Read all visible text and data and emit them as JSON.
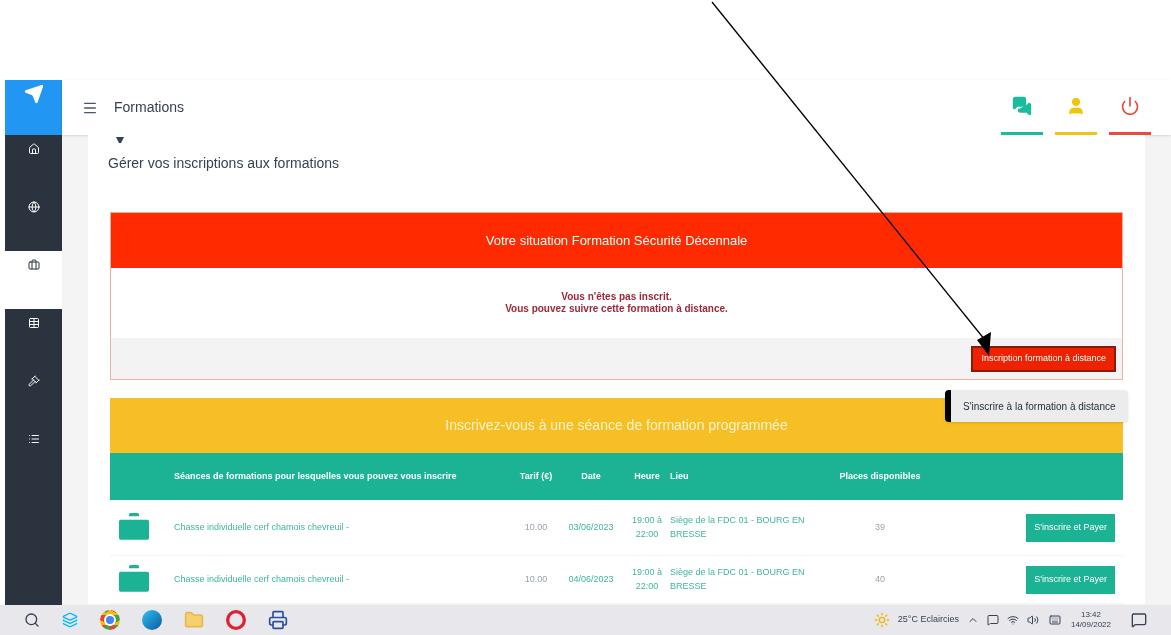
{
  "sidebar": {
    "items": [
      {
        "kind": "home",
        "selected": false
      },
      {
        "kind": "globe",
        "selected": false
      },
      {
        "kind": "briefcase",
        "selected": true
      },
      {
        "kind": "table",
        "selected": false
      },
      {
        "kind": "gavel",
        "selected": false
      },
      {
        "kind": "list",
        "selected": false
      }
    ]
  },
  "header": {
    "title": "Formations",
    "actions": [
      {
        "kind": "chat",
        "color": "#1abc9c"
      },
      {
        "kind": "user",
        "color": "#f1c40f"
      },
      {
        "kind": "power",
        "color": "#e74c3c"
      }
    ]
  },
  "page_subtitle": "Gérer vos inscriptions aux formations",
  "status_panel": {
    "title": "Votre situation Formation Sécurité Décennale",
    "messages": [
      "Vous n'êtes pas inscrit.",
      "Vous pouvez suivre cette formation à distance."
    ],
    "button": "Inscription formation à distance",
    "tooltip": "S'inscrire à la formation à distance"
  },
  "sessions_panel": {
    "title": "Inscrivez-vous à une séance de formation programmée",
    "table": {
      "columns": [
        "Séances de formations pour lesquelles vous pouvez vous inscrire",
        "Tarif (€)",
        "Date",
        "Heure",
        "Lieu",
        "Places disponibles"
      ],
      "rows": [
        {
          "name": "Chasse individuelle cerf chamois chevreuil -",
          "price": "10.00",
          "date": "03/06/2023",
          "time": "19:00 à 22:00",
          "place": "Siège de la FDC 01 - BOURG EN BRESSE",
          "seats": "39",
          "button": "S'inscrire et Payer"
        },
        {
          "name": "Chasse individuelle cerf chamois chevreuil -",
          "price": "10.00",
          "date": "04/06/2023",
          "time": "19:00 à 22:00",
          "place": "Siège de la FDC 01 - BOURG EN BRESSE",
          "seats": "40",
          "button": "S'inscrire et Payer"
        }
      ]
    }
  },
  "taskbar": {
    "apps": [
      {
        "kind": "search"
      },
      {
        "kind": "taskview"
      },
      {
        "kind": "chrome"
      },
      {
        "kind": "edge"
      },
      {
        "kind": "folder"
      },
      {
        "kind": "app"
      },
      {
        "kind": "app2"
      }
    ],
    "weather": "25°C Eclaircies",
    "time": "13:42",
    "date": "14/09/2022"
  }
}
